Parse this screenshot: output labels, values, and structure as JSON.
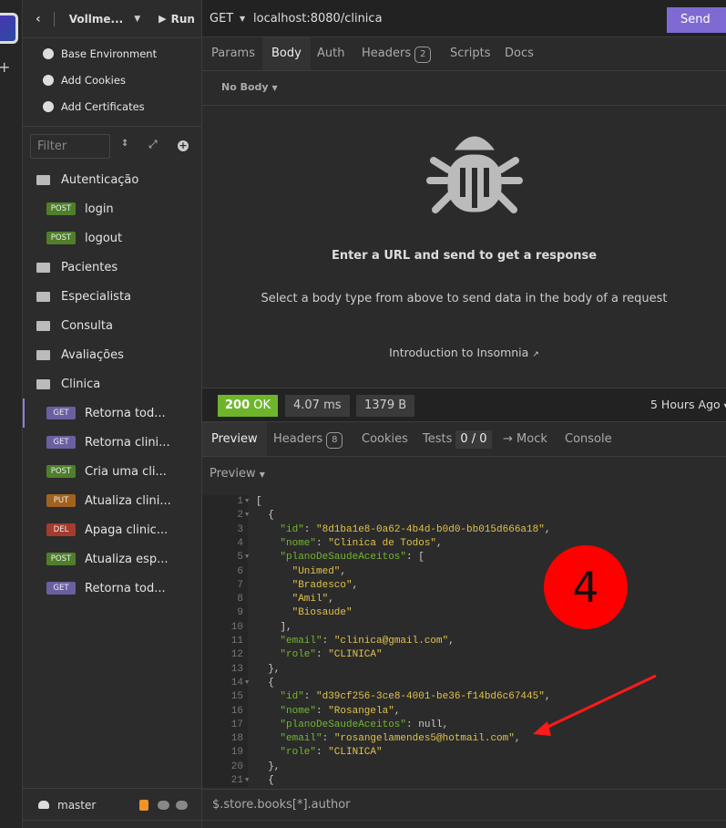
{
  "sidebar": {
    "back_icon": "chevron-left-icon",
    "project": "Vollme...",
    "run_label": "Run",
    "env_items": [
      {
        "label": "Base Environment",
        "icon": "globe-icon"
      },
      {
        "label": "Add Cookies",
        "icon": "cookie-icon"
      },
      {
        "label": "Add Certificates",
        "icon": "certificate-icon"
      }
    ],
    "filter_placeholder": "Filter",
    "tree": [
      {
        "type": "folder",
        "open": true,
        "label": "Autenticação"
      },
      {
        "type": "request",
        "method": "POST",
        "label": "login"
      },
      {
        "type": "request",
        "method": "POST",
        "label": "logout"
      },
      {
        "type": "folder",
        "label": "Pacientes"
      },
      {
        "type": "folder",
        "label": "Especialista"
      },
      {
        "type": "folder",
        "label": "Consulta"
      },
      {
        "type": "folder",
        "label": "Avaliações"
      },
      {
        "type": "folder",
        "open": true,
        "label": "Clinica"
      },
      {
        "type": "request",
        "method": "GET",
        "label": "Retorna tod...",
        "active": true
      },
      {
        "type": "request",
        "method": "GET",
        "label": "Retorna clini..."
      },
      {
        "type": "request",
        "method": "POST",
        "label": "Cria uma cli..."
      },
      {
        "type": "request",
        "method": "PUT",
        "label": "Atualiza clini..."
      },
      {
        "type": "request",
        "method": "DEL",
        "label": "Apaga clinic..."
      },
      {
        "type": "request",
        "method": "POST",
        "label": "Atualiza esp..."
      },
      {
        "type": "request",
        "method": "GET",
        "label": "Retorna tod..."
      }
    ],
    "method_colors": {
      "GET": "#6a5fa0",
      "POST": "#4f7f2b",
      "PUT": "#a0621f",
      "DEL": "#a33b2e"
    },
    "branch": "master"
  },
  "request": {
    "method": "GET",
    "url": "localhost:8080/clinica",
    "send_label": "Send",
    "tabs": [
      {
        "label": "Params"
      },
      {
        "label": "Body",
        "active": true
      },
      {
        "label": "Auth"
      },
      {
        "label": "Headers",
        "count": "2"
      },
      {
        "label": "Scripts"
      },
      {
        "label": "Docs"
      }
    ],
    "body_type": "No Body",
    "empty_title": "Enter a URL and send to get a response",
    "empty_sub": "Select a body type from above to send data in the body of a request",
    "intro_link": "Introduction to Insomnia"
  },
  "response": {
    "status": "200",
    "status_text": "OK",
    "status_color": "#6fb52c",
    "time": "4.07 ms",
    "size": "1379 B",
    "when": "5 Hours Ago",
    "tabs": [
      {
        "label": "Preview",
        "active": true
      },
      {
        "label": "Headers",
        "count": "8"
      },
      {
        "label": "Cookies"
      },
      {
        "label": "Tests",
        "count": "0 / 0"
      },
      {
        "label": "→ Mock"
      },
      {
        "label": "Console"
      }
    ],
    "preview_mode": "Preview",
    "lines": [
      {
        "n": "1",
        "fold": true,
        "i": 0,
        "t": [
          [
            "p",
            "["
          ]
        ]
      },
      {
        "n": "2",
        "fold": true,
        "i": 1,
        "t": [
          [
            "p",
            "{"
          ]
        ]
      },
      {
        "n": "3",
        "i": 2,
        "t": [
          [
            "k",
            "\"id\""
          ],
          [
            "p",
            ": "
          ],
          [
            "s",
            "\"8d1ba1e8-0a62-4b4d-b0d0-bb015d666a18\""
          ],
          [
            "p",
            ","
          ]
        ]
      },
      {
        "n": "4",
        "i": 2,
        "t": [
          [
            "k",
            "\"nome\""
          ],
          [
            "p",
            ": "
          ],
          [
            "s",
            "\"Clinica de Todos\""
          ],
          [
            "p",
            ","
          ]
        ]
      },
      {
        "n": "5",
        "fold": true,
        "i": 2,
        "t": [
          [
            "k",
            "\"planoDeSaudeAceitos\""
          ],
          [
            "p",
            ": ["
          ]
        ]
      },
      {
        "n": "6",
        "i": 3,
        "t": [
          [
            "s",
            "\"Unimed\""
          ],
          [
            "p",
            ","
          ]
        ]
      },
      {
        "n": "7",
        "i": 3,
        "t": [
          [
            "s",
            "\"Bradesco\""
          ],
          [
            "p",
            ","
          ]
        ]
      },
      {
        "n": "8",
        "i": 3,
        "t": [
          [
            "s",
            "\"Amil\""
          ],
          [
            "p",
            ","
          ]
        ]
      },
      {
        "n": "9",
        "i": 3,
        "t": [
          [
            "s",
            "\"Biosaude\""
          ]
        ]
      },
      {
        "n": "10",
        "i": 2,
        "t": [
          [
            "p",
            "],"
          ]
        ]
      },
      {
        "n": "11",
        "i": 2,
        "t": [
          [
            "k",
            "\"email\""
          ],
          [
            "p",
            ": "
          ],
          [
            "s",
            "\"clinica@gmail.com\""
          ],
          [
            "p",
            ","
          ]
        ]
      },
      {
        "n": "12",
        "i": 2,
        "t": [
          [
            "k",
            "\"role\""
          ],
          [
            "p",
            ": "
          ],
          [
            "s",
            "\"CLINICA\""
          ]
        ]
      },
      {
        "n": "13",
        "i": 1,
        "t": [
          [
            "p",
            "},"
          ]
        ]
      },
      {
        "n": "14",
        "fold": true,
        "i": 1,
        "t": [
          [
            "p",
            "{"
          ]
        ]
      },
      {
        "n": "15",
        "i": 2,
        "t": [
          [
            "k",
            "\"id\""
          ],
          [
            "p",
            ": "
          ],
          [
            "s",
            "\"d39cf256-3ce8-4001-be36-f14bd6c67445\""
          ],
          [
            "p",
            ","
          ]
        ]
      },
      {
        "n": "16",
        "i": 2,
        "t": [
          [
            "k",
            "\"nome\""
          ],
          [
            "p",
            ": "
          ],
          [
            "s",
            "\"Rosangela\""
          ],
          [
            "p",
            ","
          ]
        ]
      },
      {
        "n": "17",
        "i": 2,
        "t": [
          [
            "k",
            "\"planoDeSaudeAceitos\""
          ],
          [
            "p",
            ": null,"
          ]
        ]
      },
      {
        "n": "18",
        "i": 2,
        "t": [
          [
            "k",
            "\"email\""
          ],
          [
            "p",
            ": "
          ],
          [
            "s",
            "\"rosangelamendes5@hotmail.com\""
          ],
          [
            "p",
            ","
          ]
        ]
      },
      {
        "n": "19",
        "i": 2,
        "t": [
          [
            "k",
            "\"role\""
          ],
          [
            "p",
            ": "
          ],
          [
            "s",
            "\"CLINICA\""
          ]
        ]
      },
      {
        "n": "20",
        "i": 1,
        "t": [
          [
            "p",
            "},"
          ]
        ]
      },
      {
        "n": "21",
        "fold": true,
        "i": 1,
        "t": [
          [
            "p",
            "{"
          ]
        ]
      }
    ],
    "filter_value": "$.store.books[*].author"
  },
  "annotation": {
    "number": "4",
    "color": "#ff0000"
  }
}
